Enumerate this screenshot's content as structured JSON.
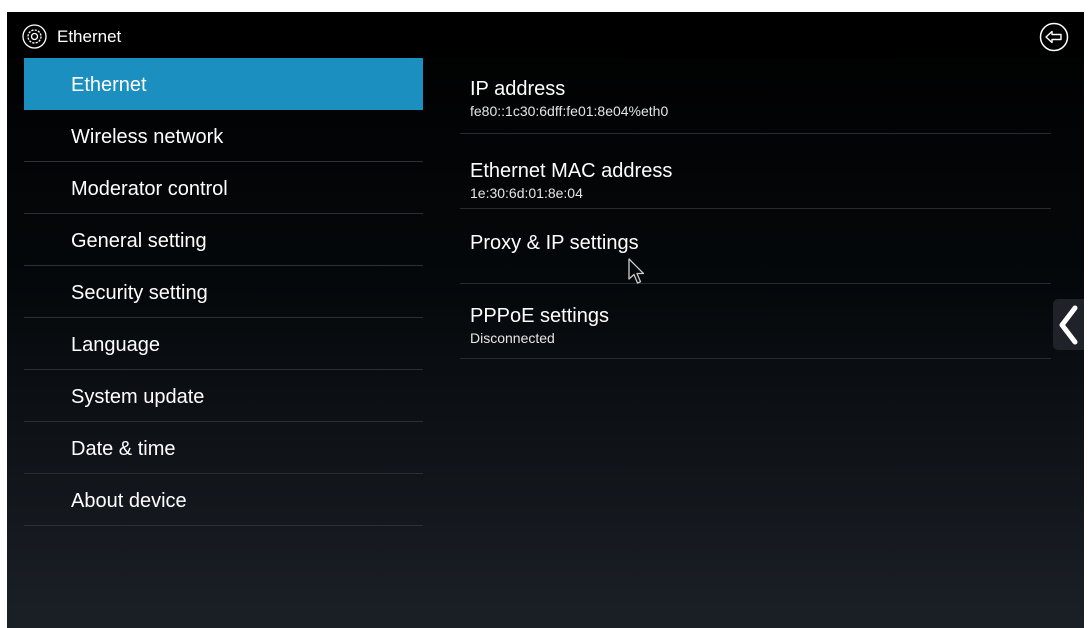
{
  "titlebar": {
    "title": "Ethernet",
    "settings_icon": "gear-icon",
    "back_icon": "back-arrow-icon"
  },
  "sidebar": {
    "items": [
      {
        "label": "Ethernet",
        "active": true
      },
      {
        "label": "Wireless network"
      },
      {
        "label": "Moderator control"
      },
      {
        "label": "General setting"
      },
      {
        "label": "Security setting"
      },
      {
        "label": "Language"
      },
      {
        "label": "System update"
      },
      {
        "label": "Date & time"
      },
      {
        "label": "About device"
      }
    ]
  },
  "content": {
    "ip": {
      "title": "IP address",
      "value": "fe80::1c30:6dff:fe01:8e04%eth0"
    },
    "mac": {
      "title": "Ethernet MAC address",
      "value": "1e:30:6d:01:8e:04"
    },
    "proxy": {
      "title": "Proxy & IP settings"
    },
    "pppoe": {
      "title": "PPPoE settings",
      "status": "Disconnected"
    }
  },
  "side_tab": {
    "icon": "chevron-left-icon"
  },
  "colors": {
    "accent": "#1a8fc0",
    "background": "#000000",
    "divider": "#2a3038",
    "text": "#ffffff"
  }
}
